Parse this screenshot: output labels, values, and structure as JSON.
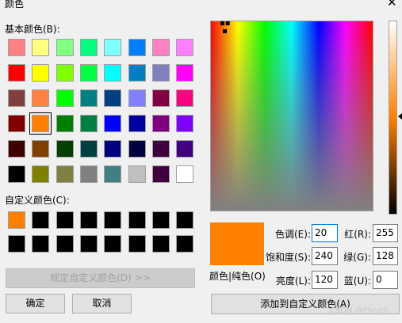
{
  "window": {
    "title": "颜色",
    "close_glyph": "✕"
  },
  "basic": {
    "label": "基本颜色(B):",
    "rows": [
      [
        "#ff8080",
        "#ffff80",
        "#80ff80",
        "#00ff80",
        "#80ffff",
        "#0080ff",
        "#ff80c0",
        "#ff80ff"
      ],
      [
        "#ff0000",
        "#ffff00",
        "#80ff00",
        "#00ff40",
        "#00ffff",
        "#0080c0",
        "#8080c0",
        "#ff00ff"
      ],
      [
        "#804040",
        "#ff8040",
        "#00ff00",
        "#008080",
        "#004080",
        "#8080ff",
        "#800040",
        "#ff0080"
      ],
      [
        "#800000",
        "#ff8000",
        "#008000",
        "#008040",
        "#0000ff",
        "#0000a0",
        "#800080",
        "#8000ff"
      ],
      [
        "#400000",
        "#804000",
        "#004000",
        "#004040",
        "#000080",
        "#000040",
        "#400040",
        "#400080"
      ],
      [
        "#000000",
        "#808000",
        "#808040",
        "#808080",
        "#408080",
        "#c0c0c0",
        "#400040",
        "#ffffff"
      ]
    ],
    "selected_row": 3,
    "selected_col": 1
  },
  "custom": {
    "label": "自定义颜色(C):",
    "rows": [
      [
        "#ff8000",
        "#000000",
        "#000000",
        "#000000",
        "#000000",
        "#000000",
        "#000000",
        "#000000"
      ],
      [
        "#000000",
        "#000000",
        "#000000",
        "#000000",
        "#000000",
        "#000000",
        "#000000",
        "#000000"
      ]
    ]
  },
  "buttons": {
    "define_custom": "规定自定义颜色(D) >>",
    "ok": "确定",
    "cancel": "取消",
    "add_custom": "添加到自定义颜色(A)"
  },
  "preview": {
    "label": "颜色|纯色(O)",
    "color": "#ff8000"
  },
  "fields": {
    "hue": {
      "label": "色调(E):",
      "value": "20"
    },
    "sat": {
      "label": "饱和度(S):",
      "value": "240"
    },
    "lum": {
      "label": "亮度(L):",
      "value": "120"
    },
    "red": {
      "label": "红(R):",
      "value": "255"
    },
    "green": {
      "label": "绿(G):",
      "value": "128"
    },
    "blue": {
      "label": "蓝(U):",
      "value": "0"
    }
  },
  "watermark": "CSDN @Phrvth"
}
